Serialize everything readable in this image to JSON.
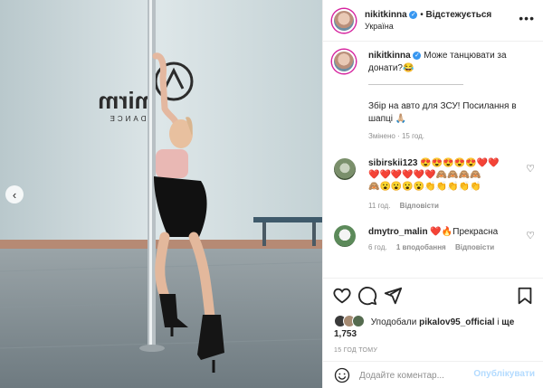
{
  "post": {
    "username": "nikitkinna",
    "follow_state": "Відстежується",
    "location": "Україна",
    "photo_alt": "Dance studio photo",
    "studio_logo_text": "mirm",
    "studio_logo_sub": "DANCE"
  },
  "caption": {
    "username": "nikitkinna",
    "text_1": "Може танцювати за донати?😂",
    "separator": "———————————————",
    "text_2": "Збір на авто для ЗСУ! Посилання в шапці 🙏🏼",
    "edited": "Змінено · 15 год."
  },
  "comments": [
    {
      "username": "sibirskii123",
      "text_line_1": "😍😍😍😍😍❤️❤️",
      "text_line_2": "❤️❤️❤️❤️❤️❤️🙈🙈🙈🙈",
      "text_line_3": "🙈😮😮😮😮👏👏👏👏👏",
      "time": "11 год.",
      "reply_label": "Відповісти"
    },
    {
      "username": "dmytro_malin",
      "text": "❤️🔥Прекрасна",
      "time": "6 год.",
      "likes_label": "1 вподобання",
      "reply_label": "Відповісти"
    }
  ],
  "likes": {
    "prefix": "Уподобали",
    "user": "pikalov95_official",
    "suffix": "і",
    "more": "ще 1,753"
  },
  "timestamp": "15 ГОД ТОМУ",
  "composer": {
    "placeholder": "Додайте коментар...",
    "post_label": "Опублікувати"
  },
  "icons": {
    "more": "more-icon",
    "like": "heart-icon",
    "comment": "comment-icon",
    "share": "share-icon",
    "save": "bookmark-icon",
    "emoji": "emoji-icon",
    "prev": "chevron-left-icon"
  },
  "colors": {
    "verified": "#3897f0",
    "link_disabled": "#b3dbff",
    "muted": "#8e8e8e"
  }
}
